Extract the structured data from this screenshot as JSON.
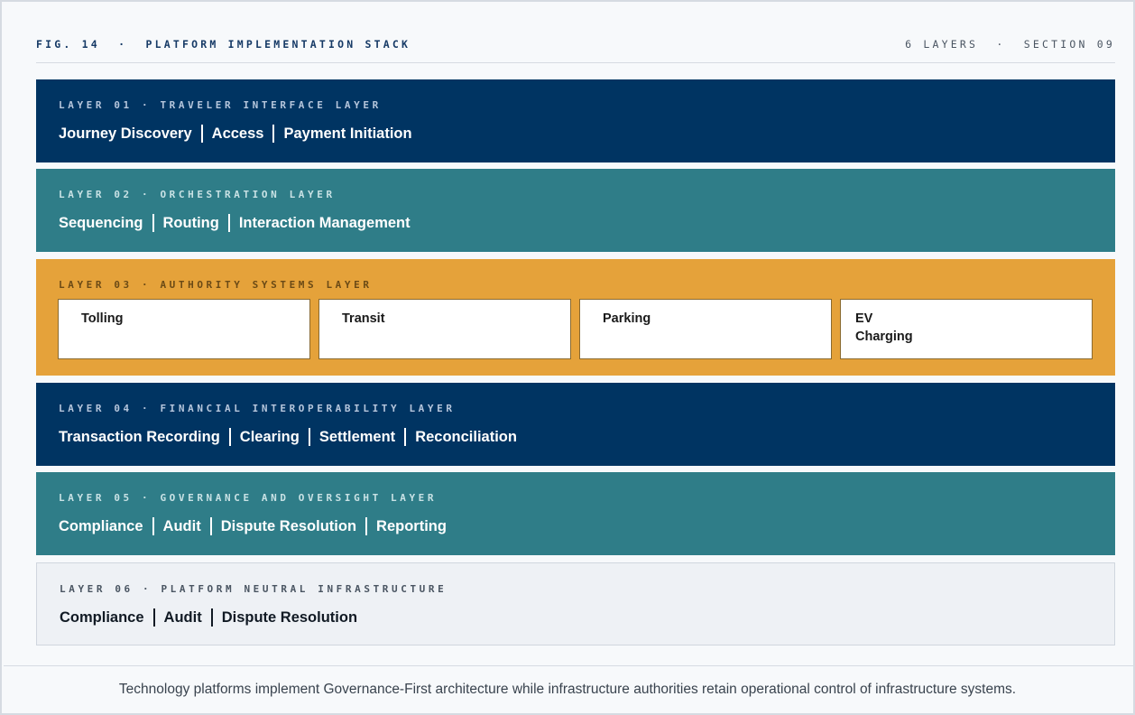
{
  "header": {
    "figure": "FIG. 14  ·  PLATFORM IMPLEMENTATION STACK",
    "meta": "6 LAYERS  ·  SECTION 09"
  },
  "layers": [
    {
      "tag": "LAYER 01 · TRAVELER INTERFACE LAYER",
      "items": [
        "Journey Discovery",
        "Access",
        "Payment Initiation"
      ],
      "color": "#003462"
    },
    {
      "tag": "LAYER 02 · ORCHESTRATION LAYER",
      "items": [
        "Sequencing",
        "Routing",
        "Interaction Management"
      ],
      "color": "#2f7d88"
    },
    {
      "tag": "LAYER 03 · AUTHORITY SYSTEMS LAYER",
      "items": [
        "Tolling",
        "Transit",
        "Parking",
        "EV\nCharging"
      ],
      "color": "#e5a23a"
    },
    {
      "tag": "LAYER 04 · FINANCIAL INTEROPERABILITY LAYER",
      "items": [
        "Transaction Recording",
        "Clearing",
        "Settlement",
        "Reconciliation"
      ],
      "color": "#003462"
    },
    {
      "tag": "LAYER 05 · GOVERNANCE AND OVERSIGHT LAYER",
      "items": [
        "Compliance",
        "Audit",
        "Dispute Resolution",
        "Reporting"
      ],
      "color": "#2f7d88"
    },
    {
      "tag": "LAYER 06 · PLATFORM NEUTRAL INFRASTRUCTURE",
      "items": [
        "Compliance",
        "Audit",
        "Dispute Resolution"
      ],
      "color": "#eef1f5"
    }
  ],
  "caption": "Technology platforms implement Governance-First architecture while infrastructure authorities retain operational control of infrastructure systems."
}
